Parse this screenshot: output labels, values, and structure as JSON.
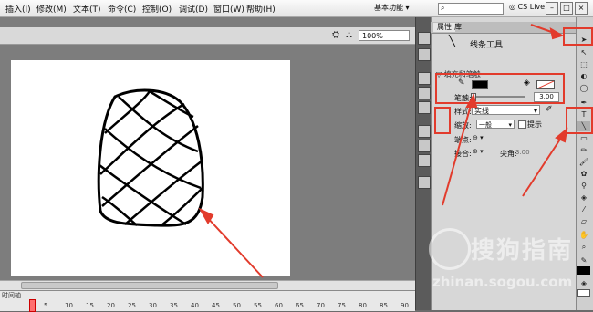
{
  "menu": {
    "items": [
      "插入(I)",
      "修改(M)",
      "文本(T)",
      "命令(C)",
      "控制(O)",
      "调试(D)",
      "窗口(W)",
      "帮助(H)"
    ],
    "workspace": "基本功能 ▾"
  },
  "topbar": {
    "cs_live": "CS Live",
    "minimize": "–",
    "restore": "□",
    "close": "×"
  },
  "stage": {
    "zoom": "100%"
  },
  "timeline": {
    "label": "时间轴",
    "frames": [
      "5",
      "10",
      "15",
      "20",
      "25",
      "30",
      "35",
      "40",
      "45",
      "50",
      "55",
      "60",
      "65",
      "70",
      "75",
      "80",
      "85",
      "90"
    ]
  },
  "panel": {
    "tab_properties": "属性",
    "tab_library": "库",
    "tool_name": "线条工具",
    "section_title": "▽ 填充和笔触",
    "stroke_label": "笔触:",
    "stroke_value": "3.00",
    "style_label": "样式:",
    "style_value": "实线",
    "scale_label": "缩放:",
    "scale_value": "一般",
    "hint_label": "提示",
    "cap_label": "端点:",
    "join_label": "接合:",
    "miter_label": "尖角:",
    "miter_value": "3.00"
  },
  "watermark": {
    "brand": "搜狗指南",
    "url": "zhinan.sogou.com"
  },
  "colors": {
    "annotation_red": "#e23b2c",
    "stroke_color": "#000000"
  }
}
